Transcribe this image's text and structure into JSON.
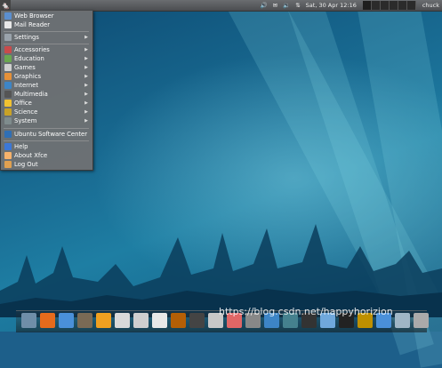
{
  "top_panel": {
    "menu_icon": "xfce-mouse-icon",
    "tray_icons": [
      "volume-icon",
      "mail-icon",
      "speaker-icon",
      "network-icon"
    ],
    "clock": "Sat, 30 Apr  12:16",
    "user": "chuck"
  },
  "menu": {
    "items": [
      {
        "label": "Web Browser",
        "icon": "web-browser-icon",
        "color": "#5b8fd0",
        "submenu": false
      },
      {
        "label": "Mail Reader",
        "icon": "mail-reader-icon",
        "color": "#e8e8e8",
        "submenu": false
      },
      {
        "label": "Settings",
        "icon": "settings-icon",
        "color": "#9aa3ab",
        "submenu": true
      },
      {
        "label": "Accessories",
        "icon": "accessories-icon",
        "color": "#c94b4b",
        "submenu": true
      },
      {
        "label": "Education",
        "icon": "education-icon",
        "color": "#6aa84f",
        "submenu": true
      },
      {
        "label": "Games",
        "icon": "games-icon",
        "color": "#d0d0d0",
        "submenu": true
      },
      {
        "label": "Graphics",
        "icon": "graphics-icon",
        "color": "#e69138",
        "submenu": true
      },
      {
        "label": "Internet",
        "icon": "internet-icon",
        "color": "#3d85c6",
        "submenu": true
      },
      {
        "label": "Multimedia",
        "icon": "multimedia-icon",
        "color": "#555555",
        "submenu": true
      },
      {
        "label": "Office",
        "icon": "office-icon",
        "color": "#f1c232",
        "submenu": true
      },
      {
        "label": "Science",
        "icon": "science-icon",
        "color": "#c9a227",
        "submenu": true
      },
      {
        "label": "System",
        "icon": "system-icon",
        "color": "#7f8c8d",
        "submenu": true
      },
      {
        "label": "Ubuntu Software Center",
        "icon": "software-center-icon",
        "color": "#2f6fb5",
        "submenu": false
      },
      {
        "label": "Help",
        "icon": "help-icon",
        "color": "#3c78d8",
        "submenu": false
      },
      {
        "label": "About Xfce",
        "icon": "about-icon",
        "color": "#f6b26b",
        "submenu": false
      },
      {
        "label": "Log Out",
        "icon": "log-out-icon",
        "color": "#e0a050",
        "submenu": false
      }
    ]
  },
  "dock": {
    "icons": [
      {
        "name": "show-desktop-icon",
        "color": "#6f8ea8"
      },
      {
        "name": "firefox-icon",
        "color": "#e66b1c"
      },
      {
        "name": "chromium-icon",
        "color": "#4a90d9"
      },
      {
        "name": "gimp-icon",
        "color": "#7a6a55"
      },
      {
        "name": "vlc-icon",
        "color": "#f0a020"
      },
      {
        "name": "text-editor-icon",
        "color": "#d9d9d9"
      },
      {
        "name": "document-viewer-icon",
        "color": "#cfcfcf"
      },
      {
        "name": "writer-icon",
        "color": "#e8e8e8"
      },
      {
        "name": "calc-icon",
        "color": "#b45f06"
      },
      {
        "name": "binoculars-icon",
        "color": "#444444"
      },
      {
        "name": "package-icon",
        "color": "#c8c8c8"
      },
      {
        "name": "cards-icon",
        "color": "#e06666"
      },
      {
        "name": "file-manager-icon",
        "color": "#888888"
      },
      {
        "name": "network-manager-icon",
        "color": "#3d85c6"
      },
      {
        "name": "diamond-icon",
        "color": "#45818e"
      },
      {
        "name": "calculator-icon",
        "color": "#333333"
      },
      {
        "name": "photo-icon",
        "color": "#6fa8dc"
      },
      {
        "name": "terminal-icon",
        "color": "#222222"
      },
      {
        "name": "keyring-icon",
        "color": "#bf9000"
      },
      {
        "name": "download-icon",
        "color": "#4a90d9"
      },
      {
        "name": "folder-icon",
        "color": "#9fb6c6"
      },
      {
        "name": "trash-icon",
        "color": "#aaaaaa"
      }
    ]
  },
  "watermark": "https://blog.csdn.net/happyhorizion"
}
